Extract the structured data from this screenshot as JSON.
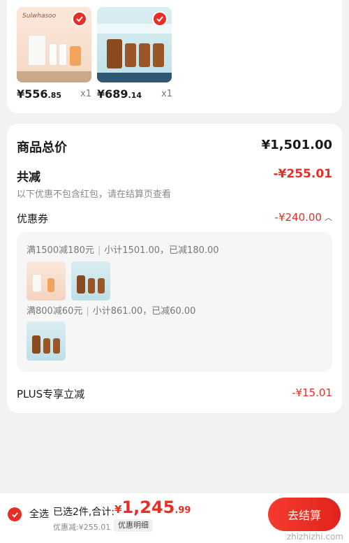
{
  "products": [
    {
      "price_int": "¥556",
      "price_dec": ".85",
      "qty": "x1",
      "brand": "Sulwhasoo",
      "accent": "#f6d7c3"
    },
    {
      "price_int": "¥689",
      "price_dec": ".14",
      "qty": "x1",
      "brand": "",
      "accent": "#bfe0e8"
    }
  ],
  "summary": {
    "total_label": "商品总价",
    "total_value": "¥1,501.00",
    "reduce_label": "共减",
    "reduce_value": "-¥255.01",
    "reduce_note": "以下优惠不包含红包，请在结算页查看",
    "coupon_label": "优惠券",
    "coupon_value": "-¥240.00",
    "tiers": [
      {
        "rule": "满1500减180元",
        "detail": "小计1501.00，已减180.00"
      },
      {
        "rule": "满800减60元",
        "detail": "小计861.00，已减60.00"
      }
    ],
    "plus_label": "PLUS专享立减",
    "plus_value": "-¥15.01"
  },
  "bottom": {
    "select_all": "全选",
    "selected_count": "已选2件,合计:",
    "grand_cur": "¥",
    "grand_int": "1,245",
    "grand_dec": ".99",
    "discount_line": "优惠减:¥255.01",
    "detail_button": "优惠明细",
    "checkout": "去结算",
    "watermark": "zhizhizhi.com"
  },
  "colors": {
    "accent": "#e62e25",
    "bg": "#f2f2f2"
  }
}
